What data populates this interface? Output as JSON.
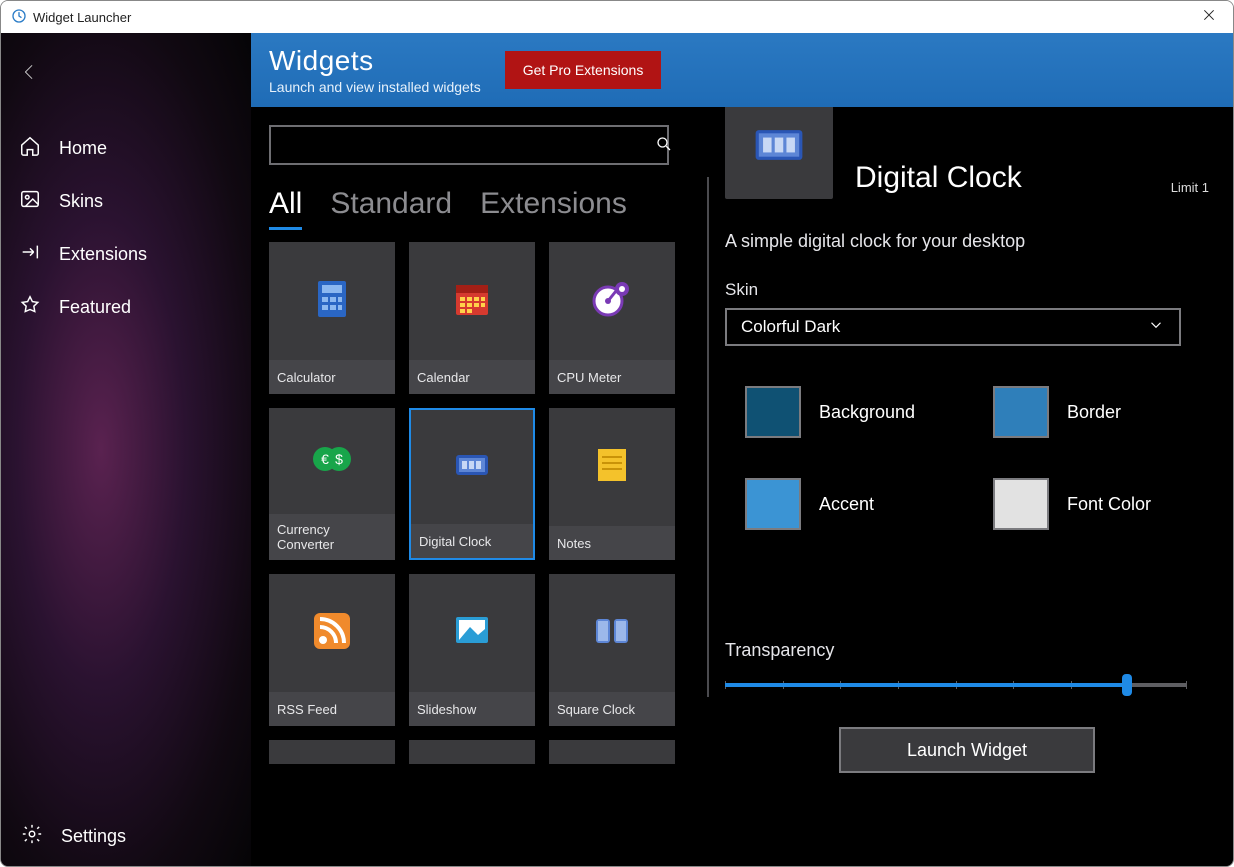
{
  "window": {
    "title": "Widget Launcher"
  },
  "sidebar": {
    "items": [
      {
        "label": "Home"
      },
      {
        "label": "Skins"
      },
      {
        "label": "Extensions"
      },
      {
        "label": "Featured"
      }
    ],
    "settings": "Settings"
  },
  "header": {
    "title": "Widgets",
    "subtitle": "Launch and view installed widgets",
    "pro_button": "Get Pro Extensions"
  },
  "search": {
    "placeholder": ""
  },
  "tabs": [
    {
      "label": "All",
      "active": true
    },
    {
      "label": "Standard",
      "active": false
    },
    {
      "label": "Extensions",
      "active": false
    }
  ],
  "widgets": [
    {
      "label": "Calculator"
    },
    {
      "label": "Calendar"
    },
    {
      "label": "CPU Meter"
    },
    {
      "label": "Currency Converter"
    },
    {
      "label": "Digital Clock",
      "selected": true
    },
    {
      "label": "Notes"
    },
    {
      "label": "RSS Feed"
    },
    {
      "label": "Slideshow"
    },
    {
      "label": "Square Clock"
    }
  ],
  "details": {
    "title": "Digital Clock",
    "limit": "Limit 1",
    "description": "A simple digital clock for your desktop",
    "skin_label": "Skin",
    "skin_value": "Colorful Dark",
    "swatches": [
      {
        "label": "Background",
        "color": "#0f5173"
      },
      {
        "label": "Border",
        "color": "#2f7fba"
      },
      {
        "label": "Accent",
        "color": "#3b94d4"
      },
      {
        "label": "Font Color",
        "color": "#e2e2e2"
      }
    ],
    "transparency_label": "Transparency",
    "transparency_percent": 87,
    "launch_button": "Launch Widget"
  }
}
